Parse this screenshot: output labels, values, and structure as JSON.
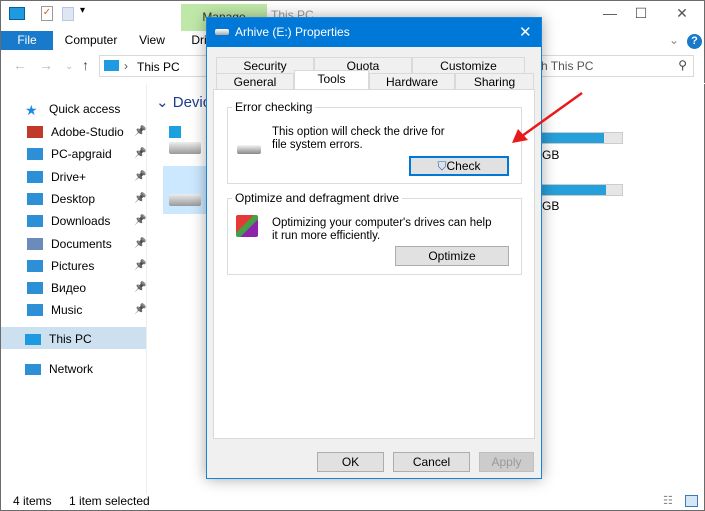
{
  "explorer": {
    "title": "This PC",
    "ribbon_tabs": [
      "File",
      "Computer",
      "View",
      "Dri"
    ],
    "manage_tab": "Manage",
    "address": "This PC",
    "search_placeholder": "Search This PC",
    "search_visible": "h This PC",
    "section": "Devices",
    "drive_bar_fill": [
      0.78,
      0.8
    ],
    "drive_unit": "GB",
    "sidebar": {
      "quick_access": "Quick access",
      "items": [
        "Adobe-Studio",
        "PC-apgraid",
        "Drive+",
        "Desktop",
        "Downloads",
        "Documents",
        "Pictures",
        "Видео",
        "Music"
      ],
      "this_pc": "This PC",
      "network": "Network"
    },
    "status": {
      "items": "4 items",
      "selected": "1 item selected"
    }
  },
  "dialog": {
    "title": "Arhive (E:) Properties",
    "tabs_row1": [
      "Security",
      "Quota",
      "Customize"
    ],
    "tabs_row2": [
      "General",
      "Tools",
      "Hardware",
      "Sharing"
    ],
    "active_tab": "Tools",
    "error_checking": {
      "label": "Error checking",
      "text": "This option will check the drive for file system errors.",
      "button": "Check"
    },
    "optimize": {
      "label": "Optimize and defragment drive",
      "text": "Optimizing your computer's drives can help it run more efficiently.",
      "button": "Optimize"
    },
    "buttons": {
      "ok": "OK",
      "cancel": "Cancel",
      "apply": "Apply"
    }
  },
  "colors": {
    "accent": "#0078d7",
    "annotation_arrow": "#e8191b"
  }
}
